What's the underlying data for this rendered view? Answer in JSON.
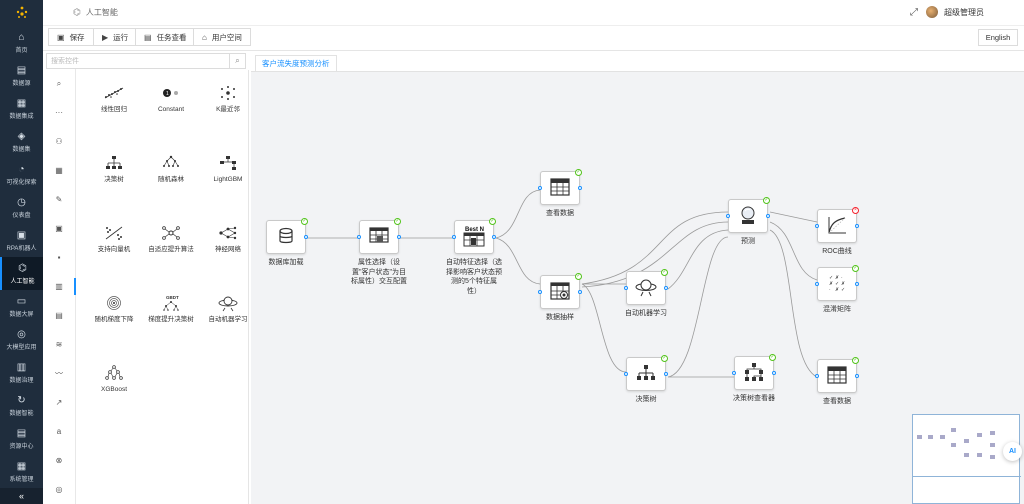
{
  "header": {
    "brand": "人工智能",
    "user_name": "超级管理员"
  },
  "toolbar": {
    "save": "保存",
    "run": "运行",
    "tasks": "任务查看",
    "user_space": "用户空间",
    "language": "English"
  },
  "nav": [
    {
      "label": "首页",
      "icon": "home-icon",
      "glyph": "⌂"
    },
    {
      "label": "数据源",
      "icon": "database-icon",
      "glyph": "▤"
    },
    {
      "label": "数据集成",
      "icon": "integration-icon",
      "glyph": "▦"
    },
    {
      "label": "数据集",
      "icon": "dataset-icon",
      "glyph": "◈"
    },
    {
      "label": "可视化探索",
      "icon": "chart-icon",
      "glyph": "◔"
    },
    {
      "label": "仪表盘",
      "icon": "dashboard-icon",
      "glyph": "◷"
    },
    {
      "label": "RPA机器人",
      "icon": "robot-icon",
      "glyph": "▣"
    },
    {
      "label": "人工智能",
      "icon": "ai-icon",
      "glyph": "⌬"
    },
    {
      "label": "数据大屏",
      "icon": "screen-icon",
      "glyph": "▭"
    },
    {
      "label": "大模型应用",
      "icon": "llm-icon",
      "glyph": "◎"
    },
    {
      "label": "数据治理",
      "icon": "governance-icon",
      "glyph": "▥"
    },
    {
      "label": "数据智能",
      "icon": "intelligence-icon",
      "glyph": "↻"
    },
    {
      "label": "资源中心",
      "icon": "resource-icon",
      "glyph": "▤"
    },
    {
      "label": "系统管理",
      "icon": "system-icon",
      "glyph": "▦"
    }
  ],
  "search": {
    "placeholder": "搜索控件"
  },
  "categories": [
    {
      "icon": "search-icon",
      "glyph": "⌕"
    },
    {
      "icon": "dots-icon",
      "glyph": "···"
    },
    {
      "icon": "robot-icon",
      "glyph": "⚇"
    },
    {
      "icon": "table-icon",
      "glyph": "▦"
    },
    {
      "icon": "pen-icon",
      "glyph": "✎"
    },
    {
      "icon": "image-icon",
      "glyph": "▣"
    },
    {
      "icon": "grid-icon",
      "glyph": "▪"
    },
    {
      "icon": "bar-chart-icon",
      "glyph": "▥"
    },
    {
      "icon": "box-icon",
      "glyph": "▤"
    },
    {
      "icon": "stack-icon",
      "glyph": "≋"
    },
    {
      "icon": "line-chart-icon",
      "glyph": "〰"
    },
    {
      "icon": "trend-icon",
      "glyph": "↗"
    },
    {
      "icon": "text-icon",
      "glyph": "a"
    },
    {
      "icon": "link-icon",
      "glyph": "⊗"
    },
    {
      "icon": "target-icon",
      "glyph": "◎"
    }
  ],
  "components": [
    {
      "label": "线性回归",
      "icon": "linear-regression-icon"
    },
    {
      "label": "Constant",
      "icon": "constant-icon"
    },
    {
      "label": "K最近邻",
      "icon": "knn-icon"
    },
    {
      "label": "决策树",
      "icon": "decision-tree-icon"
    },
    {
      "label": "随机森林",
      "icon": "random-forest-icon"
    },
    {
      "label": "LightGBM",
      "icon": "lightgbm-icon"
    },
    {
      "label": "支持向量机",
      "icon": "svm-icon"
    },
    {
      "label": "自适应提升算法",
      "icon": "adaboost-icon"
    },
    {
      "label": "神经网络",
      "icon": "neural-network-icon"
    },
    {
      "label": "随机梯度下降",
      "icon": "sgd-icon"
    },
    {
      "label": "梯度提升决策树",
      "icon": "gbdt-icon"
    },
    {
      "label": "自动机器学习",
      "icon": "automl-icon"
    },
    {
      "label": "XGBoost",
      "icon": "xgboost-icon"
    }
  ],
  "canvas": {
    "tab": "客户流失度预测分析"
  },
  "nodes": [
    {
      "label": "数据库加载",
      "icon": "database-load-icon"
    },
    {
      "label": "属性选择（设置\"客户状态\"为目标属性）交互配置",
      "icon": "attribute-select-icon"
    },
    {
      "label": "自动特征选择（选择影响客户状态预测的5个特征属性）",
      "icon": "best-n-icon",
      "badge": "Best N"
    },
    {
      "label": "查看数据",
      "icon": "view-data-icon"
    },
    {
      "label": "数据抽样",
      "icon": "sampling-icon"
    },
    {
      "label": "自动机器学习",
      "icon": "automl-icon"
    },
    {
      "label": "决策树",
      "icon": "decision-tree-icon"
    },
    {
      "label": "预测",
      "icon": "predict-icon"
    },
    {
      "label": "决策树查看器",
      "icon": "tree-viewer-icon"
    },
    {
      "label": "ROC曲线",
      "icon": "roc-icon"
    },
    {
      "label": "混淆矩阵",
      "icon": "confusion-matrix-icon"
    },
    {
      "label": "查看数据",
      "icon": "view-data-icon"
    }
  ],
  "ai_button": "AI"
}
